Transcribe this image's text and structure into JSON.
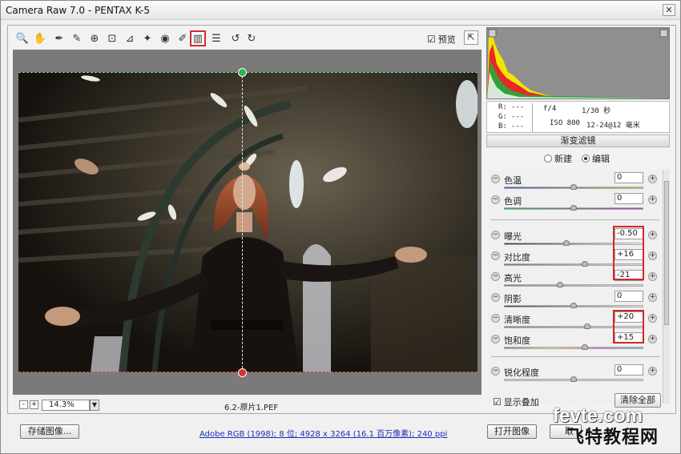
{
  "window": {
    "title": "Camera Raw 7.0 -  PENTAX K-5",
    "close_symbol": "✕"
  },
  "toolbar": {
    "tools": [
      "zoom-icon",
      "hand-icon",
      "white-balance-icon",
      "color-sampler-icon",
      "target-adjustment-icon",
      "crop-icon",
      "straighten-icon",
      "spot-removal-icon",
      "red-eye-icon",
      "adjustment-brush-icon",
      "graduated-filter-icon",
      "presets-list-icon",
      "rotate-ccw-icon",
      "rotate-cw-icon"
    ],
    "tool_glyphs": [
      "🔍",
      "✋",
      "✒",
      "✎",
      "⊕",
      "⊡",
      "⊿",
      "✦",
      "◉",
      "✐",
      "▥",
      "☰",
      "↺",
      "↻"
    ],
    "active_tool": "graduated-filter-icon",
    "preview_label": "预览",
    "preview_checked": "☑"
  },
  "image": {
    "zoom_value": "14.3%",
    "zoom_out": "-",
    "zoom_in": "+",
    "filename": "6.2-原片1.PEF"
  },
  "histogram": {
    "r_label": "R:",
    "g_label": "G:",
    "b_label": "B:",
    "r_value": "---",
    "g_value": "---",
    "b_value": "---",
    "aperture": "f/4",
    "shutter": "1/30 秒",
    "iso": "ISO 800",
    "lens": "12-24@12 毫米"
  },
  "panel": {
    "title": "渐变滤镜",
    "mode_new": "新建",
    "mode_edit": "编辑",
    "selected_mode": "编辑",
    "sliders": [
      {
        "label": "色温",
        "value": "0",
        "position": 0.5
      },
      {
        "label": "色调",
        "value": "0",
        "position": 0.5
      },
      {
        "label": "曝光",
        "value": "-0.50",
        "position": 0.45
      },
      {
        "label": "对比度",
        "value": "+16",
        "position": 0.58
      },
      {
        "label": "高光",
        "value": "-21",
        "position": 0.4
      },
      {
        "label": "阴影",
        "value": "0",
        "position": 0.5
      },
      {
        "label": "清晰度",
        "value": "+20",
        "position": 0.6
      },
      {
        "label": "饱和度",
        "value": "+15",
        "position": 0.58
      },
      {
        "label": "锐化程度",
        "value": "0",
        "position": 0.5
      }
    ],
    "show_overlay_label": "显示叠加",
    "show_overlay_checked": "☑",
    "clear_all": "清除全部"
  },
  "footer": {
    "save_image": "存储图像...",
    "color_info": "Adobe RGB (1998); 8 位; 4928 x 3264 (16.1 百万像素); 240 ppi",
    "open_image": "打开图像",
    "cancel": "取"
  },
  "watermark": {
    "line1": "fevte.com",
    "line2": "飞特教程网"
  },
  "colors": {
    "highlight_red": "#d62525",
    "link_blue": "#1a2fb5",
    "guide_green": "#2db34a",
    "guide_red": "#d93030"
  }
}
